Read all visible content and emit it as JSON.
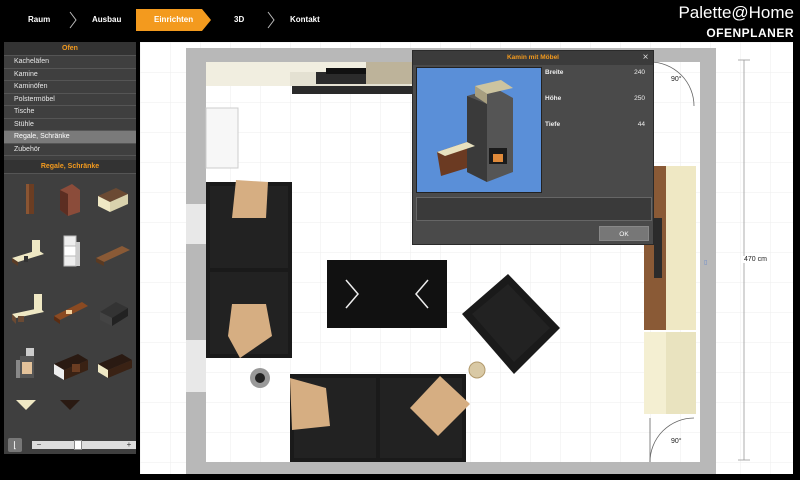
{
  "nav": {
    "steps": [
      {
        "label": "Raum"
      },
      {
        "label": "Ausbau"
      },
      {
        "label": "Einrichten"
      },
      {
        "label": "3D"
      },
      {
        "label": "Kontakt"
      }
    ],
    "active_step": "Einrichten"
  },
  "brand": {
    "name": "Palette@Home",
    "subtitle": "OFENPLANER"
  },
  "sidebar": {
    "header": "Ofen",
    "items": [
      {
        "label": "Kacheläfen"
      },
      {
        "label": "Kamine"
      },
      {
        "label": "Kaminöfen"
      },
      {
        "label": "Polstermöbel"
      },
      {
        "label": "Tische"
      },
      {
        "label": "Stühle"
      },
      {
        "label": "Regale, Schränke"
      },
      {
        "label": "Zubehör"
      }
    ],
    "selected_item": "Regale, Schränke",
    "subheader": "Regale, Schränke"
  },
  "plan": {
    "dimension_label": "470 cm",
    "angle_top": "90°",
    "angle_bottom": "90°"
  },
  "dialog": {
    "title": "Kamin mit Möbel",
    "props": [
      {
        "label": "Breite",
        "value": "240"
      },
      {
        "label": "Höhe",
        "value": "250"
      },
      {
        "label": "Tiefe",
        "value": "44"
      }
    ],
    "ok_label": "OK",
    "close_label": "×"
  },
  "colors": {
    "accent": "#f39a1e",
    "panel": "#3f3f3f",
    "preview_bg": "#5a8fd8"
  }
}
